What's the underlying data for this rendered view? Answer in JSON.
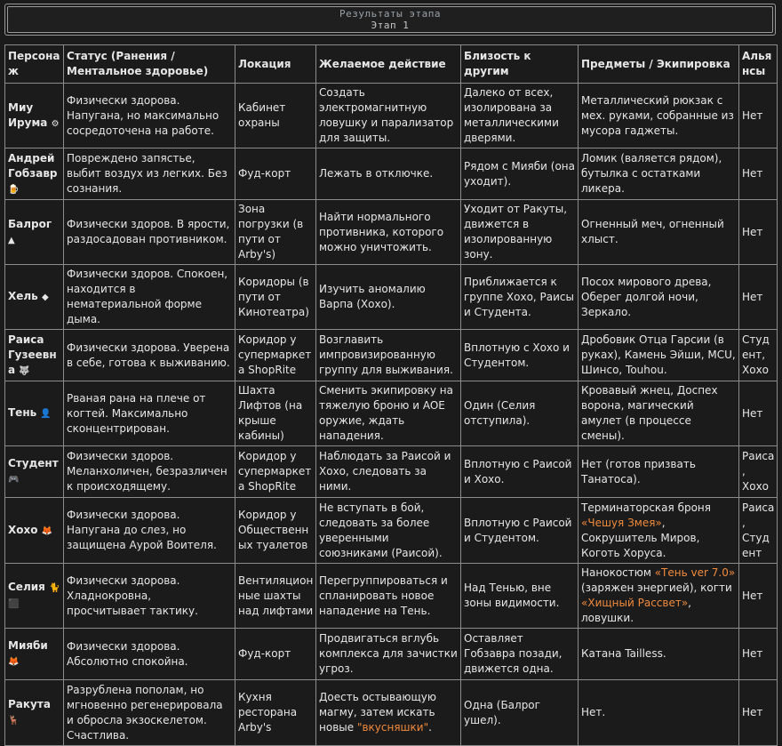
{
  "header": {
    "title": "Результаты этапа",
    "subtitle": "Этап 1"
  },
  "columns": [
    "Персонаж",
    "Статус (Ранения / Ментальное здоровье)",
    "Локация",
    "Желаемое действие",
    "Близость к другим",
    "Предметы / Экипировка",
    "Альянсы"
  ],
  "colors": {
    "highlight": "#f08a3c",
    "background": "#1b1b1b",
    "border": "#8c8c8c"
  },
  "rows": [
    {
      "name": "Миу Ирума",
      "icon": "gear-icon",
      "glyph": "⚙",
      "status": "Физически здорова. Напугана, но максимально сосредоточена на работе.",
      "location": "Кабинет охраны",
      "action": "Создать электромагнитную ловушку и парализатор для защиты.",
      "proximity": "Далеко от всех, изолирована за металлическими дверями.",
      "items": "Металлический рюкзак с мех. руками, собранные из мусора гаджеты.",
      "alliance": "Нет"
    },
    {
      "name": "Андрей Гобзавр",
      "icon": "beer-icon",
      "glyph": "🍺",
      "status": "Повреждено запястье, выбит воздух из легких. Без сознания.",
      "location": "Фуд-корт",
      "action": "Лежать в отключке.",
      "proximity": "Рядом с Мияби (она уходит).",
      "items": "Ломик (валяется рядом), бутылка с остатками ликера.",
      "alliance": "Нет"
    },
    {
      "name": "Балрог",
      "icon": "potion-icon",
      "glyph": "▲",
      "status": "Физически здоров. В ярости, раздосадован противником.",
      "location": "Зона погрузки (в пути от Arby's)",
      "action": "Найти нормального противника, которого можно уничтожить.",
      "proximity": "Уходит от Ракуты, движется в изолированную зону.",
      "items": "Огненный меч, огненный хлыст.",
      "alliance": "Нет"
    },
    {
      "name": "Хель",
      "icon": "crystal-icon",
      "glyph": "◆",
      "status": "Физически здоров. Спокоен, находится в нематериальной форме дыма.",
      "location": "Коридоры (в пути от Кинотеатра)",
      "action": "Изучить аномалию Варпа (Хохо).",
      "proximity": "Приближается к группе Хохо, Раисы и Студента.",
      "items": "Посох мирового древа, Оберег долгой ночи, Зеркало.",
      "alliance": "Нет"
    },
    {
      "name": "Раиса Гузеевна",
      "icon": "wolf-icon",
      "glyph": "🐺",
      "status": "Физически здорова. Уверена в себе, готова к выживанию.",
      "location": "Коридор у супермаркета ShopRite",
      "action": "Возглавить импровизированную группу для выживания.",
      "proximity": "Вплотную с Хохо и Студентом.",
      "items": "Дробовик Отца Гарсии (в руках), Камень Эйши, MCU, Шинсо, Touhou.",
      "alliance": "Студент, Хохо"
    },
    {
      "name": "Тень",
      "icon": "ghost-icon",
      "glyph": "👤",
      "status": "Рваная рана на плече от когтей. Максимально сконцентрирован.",
      "location": "Шахта Лифтов (на крыше кабины)",
      "action": "Сменить экипировку на тяжелую броню и AOE оружие, ждать нападения.",
      "proximity": "Один (Селия отступила).",
      "items": "Кровавый жнец, Доспех ворона, магический амулет (в процессе смены).",
      "alliance": "Нет"
    },
    {
      "name": "Студент",
      "icon": "gamepad-icon",
      "glyph": "🎮",
      "status": "Физически здоров. Меланхоличен, безразличен к происходящему.",
      "location": "Коридор у супермаркета ShopRite",
      "action": "Наблюдать за Раисой и Хохо, следовать за ними.",
      "proximity": "Вплотную с Раисой и Хохо.",
      "items": "Нет (готов призвать Танатоса).",
      "alliance": "Раиса, Хохо"
    },
    {
      "name": "Хохо",
      "icon": "fox-icon",
      "glyph": "🦊",
      "status": "Физически здорова. Напугана до слез, но защищена Аурой Воителя.",
      "location": "Коридор у Общественных туалетов",
      "action": "Не вступать в бой, следовать за более уверенными союзниками (Раисой).",
      "proximity": "Вплотную с Раисой и Студентом.",
      "items_a": "Терминаторская броня ",
      "items_hl1": "«Чешуя Змея»",
      "items_b": ", Сокрушитель Миров, Коготь Хоруса.",
      "alliance": "Раиса, Студент"
    },
    {
      "name": "Селия",
      "icon": "cat-icon",
      "glyph": "🐈⬛",
      "status": "Физически здорова. Хладнокровна, просчитывает тактику.",
      "location": "Вентиляционные шахты над лифтами",
      "action": "Перегруппироваться и спланировать новое нападение на Тень.",
      "proximity": "Над Тенью, вне зоны видимости.",
      "items_a": "Нанокостюм ",
      "items_hl1": "«Тень ver 7.0»",
      "items_b": " (заряжен энергией), когти ",
      "items_hl2": "«Хищный Рассвет»",
      "items_c": ", ловушки.",
      "alliance": "Нет"
    },
    {
      "name": "Мияби",
      "icon": "fox-icon",
      "glyph": "🦊",
      "status": "Физически здорова. Абсолютно спокойна.",
      "location": "Фуд-корт",
      "action": "Продвигаться вглубь комплекса для зачистки угроз.",
      "proximity": "Оставляет Гобзавра позади, движется одна.",
      "items": "Катана Tailless.",
      "alliance": "Нет"
    },
    {
      "name": "Ракута",
      "icon": "deer-icon",
      "glyph": "🦌",
      "status": "Разрублена пополам, но мгновенно регенерировала и обросла экзоскелетом. Счастлива.",
      "location": "Кухня ресторана Arby's",
      "action_a": "Доесть остывающую магму, затем искать новые ",
      "action_hl": "\"вкусняшки\"",
      "action_b": ".",
      "proximity": "Одна (Балрог ушел).",
      "items": "Нет.",
      "alliance": "Нет"
    }
  ]
}
